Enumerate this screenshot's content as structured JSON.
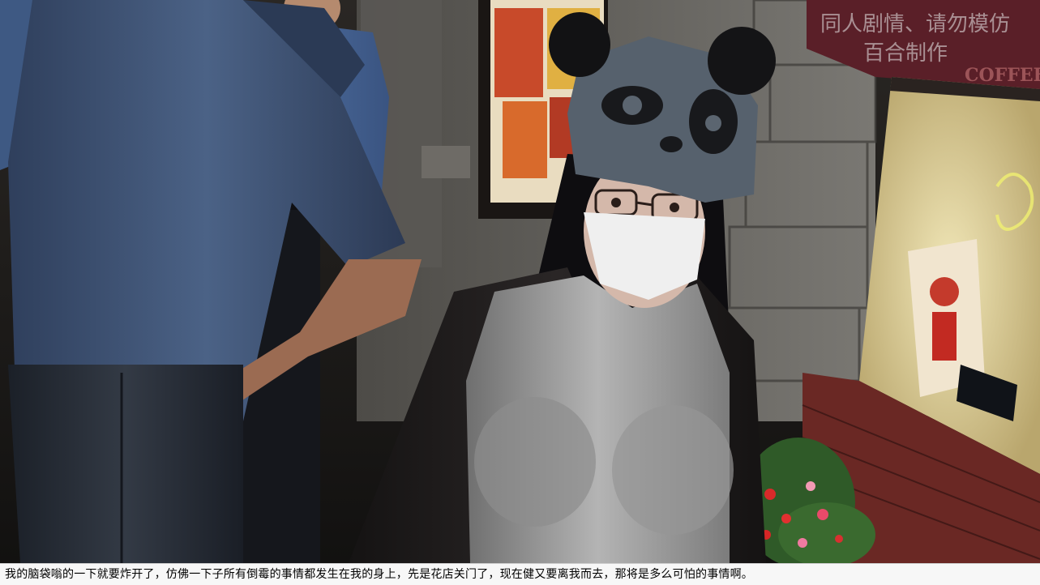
{
  "watermark": {
    "line1": "同人剧情、请勿模仿",
    "line2": "百合制作"
  },
  "awning_sign": "COFFEE",
  "caption": "我的脑袋嗡的一下就要炸开了，仿佛一下子所有倒霉的事情都发生在我的身上，先是花店关门了，现在健又要离我而去，那将是多么可怕的事情啊。",
  "colors": {
    "shirt_blue": "#3e5273",
    "wall_stone": "#6b6a66",
    "shop_glow": "#e8dcae",
    "brick": "#7a2e2a",
    "hat_gray": "#4f5a66",
    "caption_bg": "#f7f7f7"
  }
}
